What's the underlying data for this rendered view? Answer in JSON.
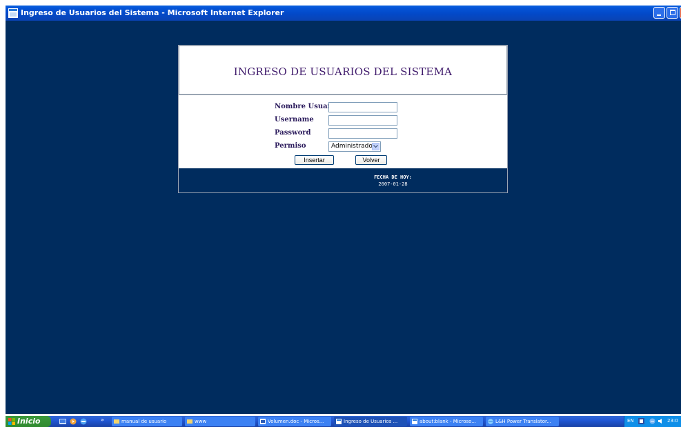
{
  "window": {
    "title": "Ingreso de Usuarios del Sistema - Microsoft Internet Explorer"
  },
  "login": {
    "heading": "INGRESO DE USUARIOS DEL SISTEMA",
    "fields": [
      {
        "label": "Nombre Usuario",
        "value": ""
      },
      {
        "label": "Username",
        "value": ""
      },
      {
        "label": "Password",
        "value": ""
      }
    ],
    "permiso": {
      "label": "Permiso",
      "selected": "Administrador"
    },
    "buttons": {
      "insert": "Insertar",
      "back": "Volver"
    },
    "footer": {
      "date_label": "FECHA DE HOY:",
      "date_value": "2007-01-28"
    }
  },
  "taskbar": {
    "start_label": "Inicio",
    "tasks": [
      {
        "label": "manual de usuario"
      },
      {
        "label": "www"
      },
      {
        "label": "Volumen.doc - Micros..."
      },
      {
        "label": "Ingreso de Usuarios ..."
      },
      {
        "label": "about:blank - Microso..."
      },
      {
        "label": "L&H Power Translator..."
      }
    ],
    "tray": {
      "language": "EN",
      "clock": "23:0"
    }
  },
  "colors": {
    "page_background": "#002c5e",
    "heading": "#3f1a6b",
    "titlebar": "#0453d6"
  }
}
